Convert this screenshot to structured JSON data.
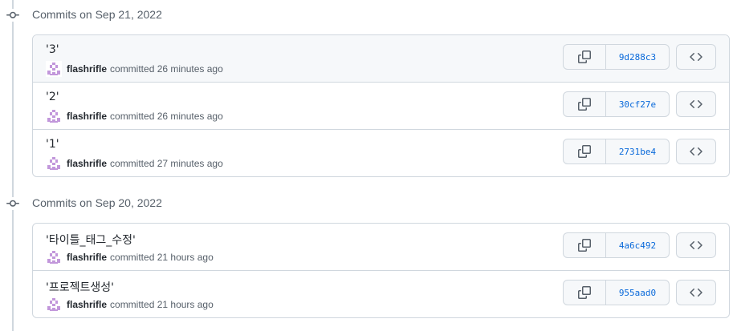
{
  "colors": {
    "link": "#0969da",
    "border": "#d0d7de",
    "muted": "#57606a",
    "avatar": "#c297db"
  },
  "groups": [
    {
      "title": "Commits on Sep 21, 2022",
      "commits": [
        {
          "message": "'3'",
          "author": "flashrifle",
          "action": "committed",
          "time": "26 minutes ago",
          "sha": "9d288c3"
        },
        {
          "message": "'2'",
          "author": "flashrifle",
          "action": "committed",
          "time": "26 minutes ago",
          "sha": "30cf27e"
        },
        {
          "message": "'1'",
          "author": "flashrifle",
          "action": "committed",
          "time": "27 minutes ago",
          "sha": "2731be4"
        }
      ]
    },
    {
      "title": "Commits on Sep 20, 2022",
      "commits": [
        {
          "message": "'타이틀_태그_수정'",
          "author": "flashrifle",
          "action": "committed",
          "time": "21 hours ago",
          "sha": "4a6c492"
        },
        {
          "message": "'프로젝트생성'",
          "author": "flashrifle",
          "action": "committed",
          "time": "21 hours ago",
          "sha": "955aad0"
        }
      ]
    }
  ]
}
